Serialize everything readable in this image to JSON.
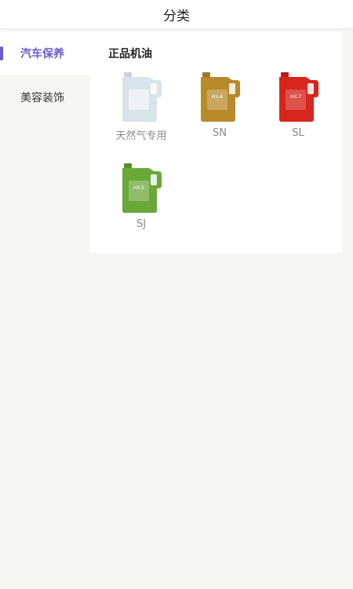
{
  "header": {
    "title": "分类"
  },
  "sidebar": {
    "items": [
      {
        "label": "汽车保养",
        "active": true
      },
      {
        "label": "美容装饰",
        "active": false
      }
    ]
  },
  "content": {
    "section_title": "正品机油",
    "products": [
      {
        "label": "天然气专用",
        "color": "#d9e3ea",
        "cap": "#c8d2d8",
        "badge_text": ""
      },
      {
        "label": "SN",
        "color": "#b88a2c",
        "cap": "#a27722",
        "badge_text": "HX-6"
      },
      {
        "label": "SL",
        "color": "#d8261f",
        "cap": "#b81c17",
        "badge_text": "HX-7"
      },
      {
        "label": "SJ",
        "color": "#6aa83a",
        "cap": "#55902c",
        "badge_text": "HX-5"
      }
    ]
  },
  "colors": {
    "accent": "#6a5cc9",
    "page_bg": "#f6f6f4"
  }
}
